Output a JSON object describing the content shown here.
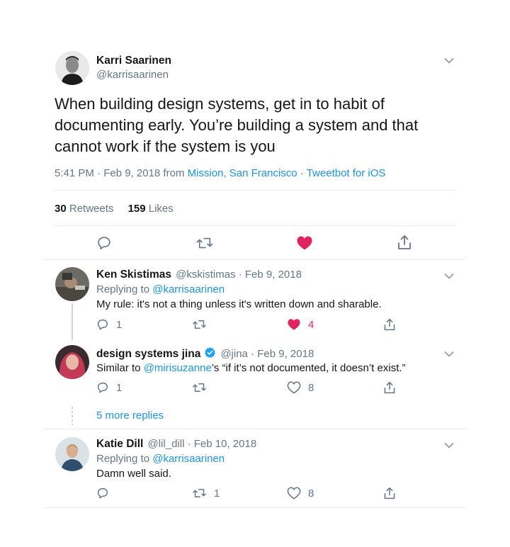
{
  "tweet": {
    "author_name": "Karri Saarinen",
    "author_handle": "@karrisaarinen",
    "text_lines": [
      "When building design systems, get in to habit of",
      "documenting early. You’re building a system and that",
      "cannot work if the system is you"
    ],
    "time_date": "5:41 PM · Feb 9, 2018 from ",
    "location": "Mission, San Francisco",
    "dot": " · ",
    "client": "Tweetbot for iOS",
    "retweets_count": "30",
    "retweets_label": " Retweets",
    "likes_count": "159",
    "likes_label": " Likes",
    "liked": true
  },
  "replies": [
    {
      "name": "Ken Skistimas",
      "handle": "@kskistimas",
      "date": " · Feb 9, 2018",
      "replying_prefix": "Replying to ",
      "replying_to": "@karrisaarinen",
      "text": "My rule: it's not a thing unless it's written down and sharable.",
      "reply_count": "1",
      "retweet_count": "",
      "like_count": "4",
      "liked": true
    },
    {
      "name": "design systems jina",
      "verified": true,
      "handle": "@jina",
      "date": " · Feb 9, 2018",
      "text_prefix": "Similar to ",
      "mention": "@mirisuzanne",
      "text_suffix": "’s “if it’s not documented, it doesn’t exist.”",
      "reply_count": "1",
      "retweet_count": "",
      "like_count": "8",
      "liked": false
    },
    {
      "name": "Katie Dill",
      "handle": "@lil_dill",
      "date": " · Feb 10, 2018",
      "replying_prefix": "Replying to ",
      "replying_to": "@karrisaarinen",
      "text": "Damn well said.",
      "reply_count": "",
      "retweet_count": "1",
      "like_count": "8",
      "liked": false
    }
  ],
  "more_replies": "5 more replies",
  "colors": {
    "accent": "#1b95e0",
    "like": "#e0245e",
    "muted": "#657786",
    "divider": "#e6ecf0"
  },
  "icons": [
    "chevron-down-icon",
    "reply-icon",
    "retweet-icon",
    "heart-icon",
    "share-icon",
    "verified-icon"
  ]
}
